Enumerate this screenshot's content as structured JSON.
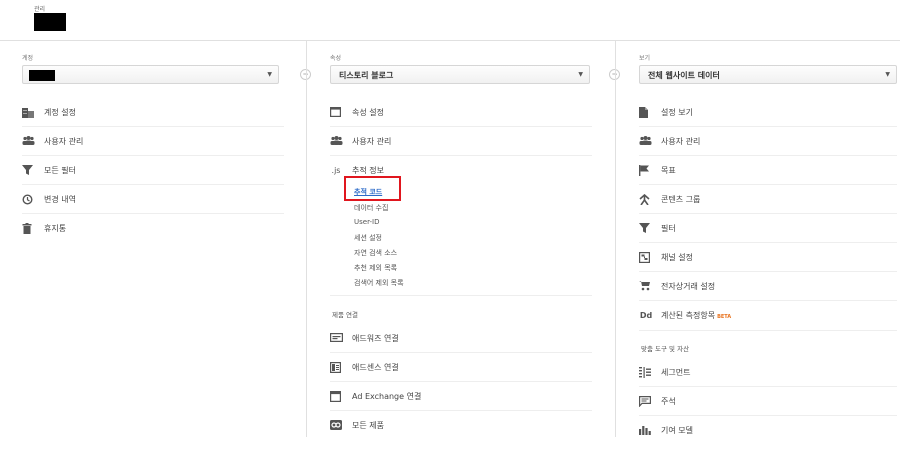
{
  "header": {
    "label": "관리"
  },
  "account": {
    "label": "계정",
    "menu": [
      {
        "icon": "building-icon",
        "label": "계정 설정"
      },
      {
        "icon": "users-icon",
        "label": "사용자 관리"
      },
      {
        "icon": "filter-icon",
        "label": "모든 필터"
      },
      {
        "icon": "history-icon",
        "label": "변경 내역"
      },
      {
        "icon": "trash-icon",
        "label": "휴지통"
      }
    ]
  },
  "property": {
    "label": "속성",
    "selected": "티스토리 블로그",
    "menu": [
      {
        "icon": "property-window-icon",
        "label": "속성 설정"
      },
      {
        "icon": "users-icon",
        "label": "사용자 관리"
      },
      {
        "icon": "js-icon",
        "icon_text": ".js",
        "label": "추적 정보"
      }
    ],
    "tracking_sub": [
      "추적 코드",
      "데이터 수집",
      "User-ID",
      "세션 설정",
      "자연 검색 소스",
      "추천 제외 목록",
      "검색어 제외 목록"
    ],
    "product_link_title": "제품 연결",
    "product_links": [
      {
        "icon": "adwords-icon",
        "label": "애드워즈 연결"
      },
      {
        "icon": "adsense-icon",
        "label": "애드센스 연결"
      },
      {
        "icon": "adexchange-icon",
        "label": "Ad Exchange 연결"
      },
      {
        "icon": "link-icon",
        "label": "모든 제품"
      }
    ]
  },
  "view": {
    "label": "보기",
    "selected": "전체 웹사이트 데이터",
    "menu": [
      {
        "icon": "document-icon",
        "label": "설정 보기"
      },
      {
        "icon": "users-icon",
        "label": "사용자 관리"
      },
      {
        "icon": "flag-icon",
        "label": "목표"
      },
      {
        "icon": "content-group-icon",
        "label": "콘텐츠 그룹"
      },
      {
        "icon": "filter-icon",
        "label": "필터"
      },
      {
        "icon": "channel-icon",
        "label": "채널 설정"
      },
      {
        "icon": "cart-icon",
        "label": "전자상거래 설정"
      },
      {
        "icon": "dd-icon",
        "icon_text": "Dd",
        "label": "계산된 측정항목",
        "badge": "BETA"
      }
    ],
    "tools_title": "맞춤 도구 및 자산",
    "tools": [
      {
        "icon": "segment-icon",
        "label": "세그먼트"
      },
      {
        "icon": "annotation-icon",
        "label": "주석"
      },
      {
        "icon": "attribution-icon",
        "label": "기여 모델"
      }
    ]
  }
}
